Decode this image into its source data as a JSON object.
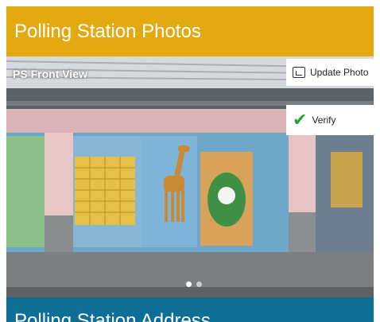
{
  "header": {
    "title": "Polling Station Photos",
    "bg_color": "#e3a910"
  },
  "photo": {
    "label": "PS Front View",
    "update_button_label": "Update Photo",
    "verify_button_label": "Verify",
    "carousel_dots": 2,
    "active_dot": 1
  },
  "section": {
    "title": "Polling Station Address",
    "bg_color": "#0e6f96"
  },
  "icons": {
    "update": "image-icon",
    "verify": "checkmark-icon"
  }
}
